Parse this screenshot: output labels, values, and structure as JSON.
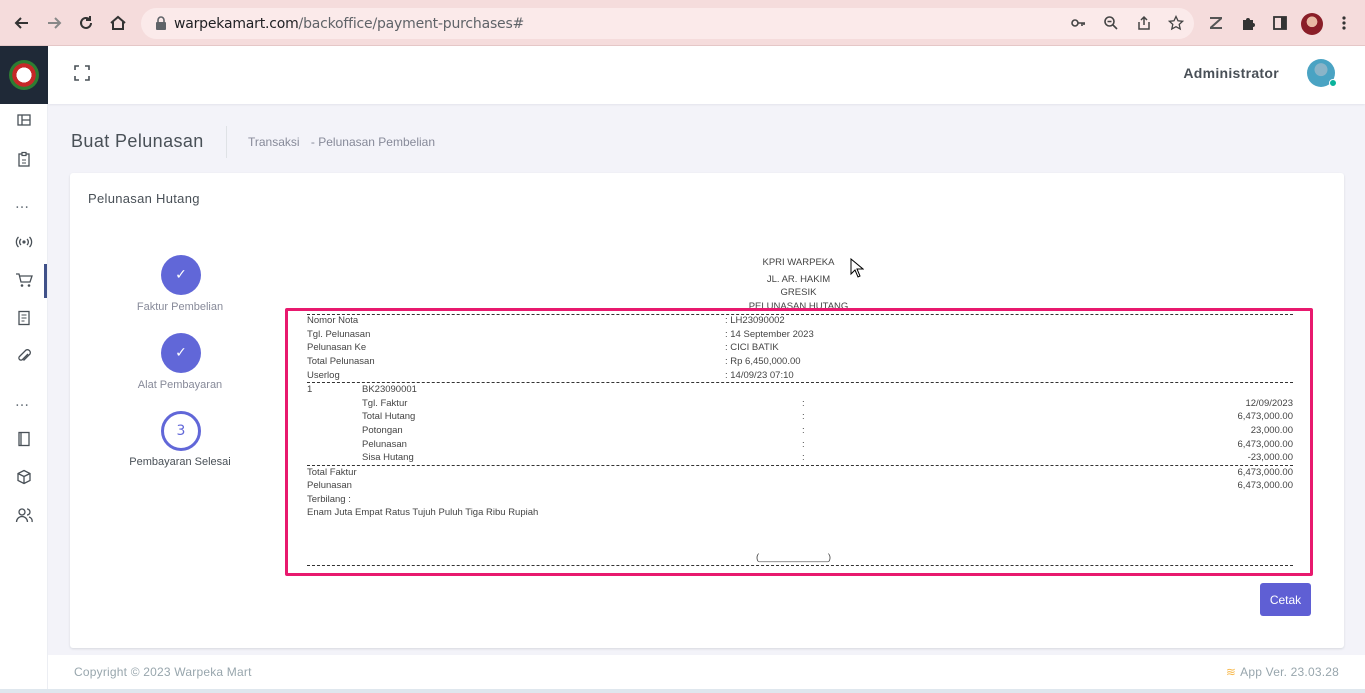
{
  "browser": {
    "url_host": "warpekamart.com",
    "url_path": "/backoffice/payment-purchases#",
    "back_icon": "arrow-left-icon",
    "forward_icon": "arrow-right-icon",
    "reload_icon": "reload-icon",
    "home_icon": "home-icon"
  },
  "topbar": {
    "admin_name": "Administrator"
  },
  "page": {
    "title": "Buat Pelunasan",
    "breadcrumb": [
      "Transaksi",
      "- Pelunasan Pembelian"
    ]
  },
  "card": {
    "title": "Pelunasan Hutang",
    "steps": [
      {
        "label": "Faktur Pembelian",
        "state": "done",
        "mark": "✓"
      },
      {
        "label": "Alat Pembayaran",
        "state": "done",
        "mark": "✓"
      },
      {
        "label": "Pembayaran Selesai",
        "state": "current",
        "mark": "3"
      }
    ],
    "print_label": "Cetak"
  },
  "receipt": {
    "org": "KPRI WARPEKA",
    "address": "JL. AR. HAKIM",
    "city": "GRESIK",
    "doc_title": "PELUNASAN HUTANG",
    "header_rows": [
      {
        "label": "Nomor Nota",
        "value": ": LH23090002"
      },
      {
        "label": "Tgl. Pelunasan",
        "value": ": 14 September 2023"
      },
      {
        "label": "Pelunasan Ke",
        "value": ": CICI BATIK"
      },
      {
        "label": "Total Pelunasan",
        "value": ": Rp 6,450,000.00"
      },
      {
        "label": "Userlog",
        "value": ": 14/09/23 07:10"
      }
    ],
    "item_no": "1",
    "item_code": "BK23090001",
    "item_rows": [
      {
        "label": "Tgl. Faktur",
        "sep": ":",
        "value": "12/09/2023"
      },
      {
        "label": "Total Hutang",
        "sep": ":",
        "value": "6,473,000.00"
      },
      {
        "label": "Potongan",
        "sep": ":",
        "value": "23,000.00"
      },
      {
        "label": "Pelunasan",
        "sep": ":",
        "value": "6,473,000.00"
      },
      {
        "label": "Sisa Hutang",
        "sep": ":",
        "value": "-23,000.00"
      }
    ],
    "total_faktur_label": "Total Faktur",
    "total_faktur_value": "6,473,000.00",
    "pelunasan_label": "Pelunasan",
    "pelunasan_value": "6,473,000.00",
    "terbilang_label": "Terbilang :",
    "terbilang_text": "Enam Juta Empat Ratus Tujuh Puluh Tiga Ribu Rupiah",
    "signature": "(_____________)"
  },
  "footer": {
    "copyright": "Copyright © 2023 Warpeka Mart",
    "version": "App Ver. 23.03.28"
  },
  "colors": {
    "accent": "#6167d8",
    "highlight": "#e8196e",
    "print_button": "#5f5fd4"
  }
}
